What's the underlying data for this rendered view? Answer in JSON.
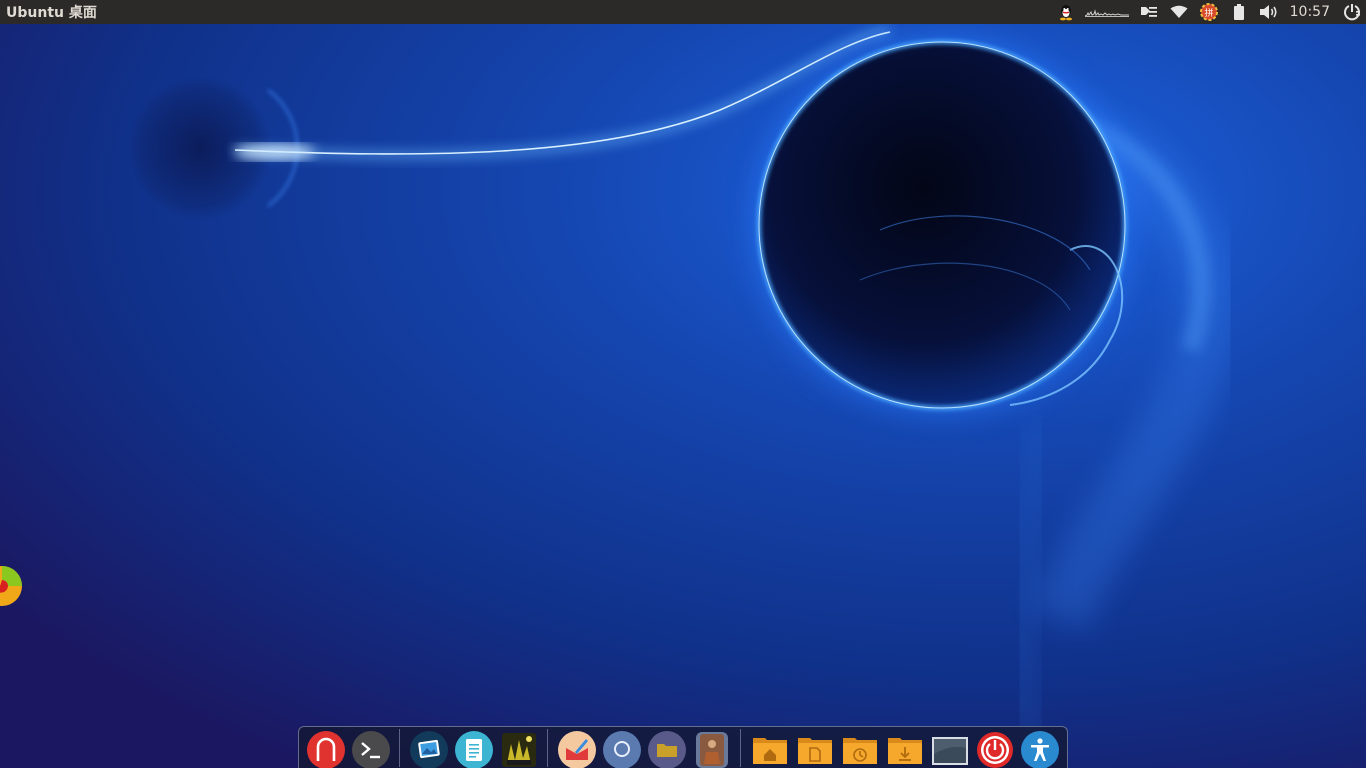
{
  "panel": {
    "title": "Ubuntu 桌面",
    "clock": "10:57"
  },
  "indicators": [
    {
      "name": "qq-icon"
    },
    {
      "name": "system-monitor-graph-icon"
    },
    {
      "name": "messaging-menu-icon"
    },
    {
      "name": "wifi-icon"
    },
    {
      "name": "input-method-icon"
    },
    {
      "name": "battery-icon"
    },
    {
      "name": "volume-icon"
    },
    {
      "name": "session-menu-icon"
    }
  ],
  "dock": {
    "apps": [
      {
        "name": "app-launcher-icon",
        "color": "#e0332f",
        "running": false
      },
      {
        "name": "terminal-icon",
        "color": "#4a4a4c",
        "running": true
      },
      {
        "name": "image-viewer-icon",
        "color": "#1e4a6a",
        "running": false
      },
      {
        "name": "text-editor-icon",
        "color": "#3cb4d2",
        "running": false
      },
      {
        "name": "game-icon",
        "color": "#c9b82a",
        "running": false
      },
      {
        "name": "drawing-app-icon",
        "color": "#f4c9a0",
        "running": false
      },
      {
        "name": "search-icon",
        "color": "#5a7ab0",
        "running": true
      },
      {
        "name": "folder-app-icon",
        "color": "#5a5a8a",
        "running": true
      },
      {
        "name": "photo-app-icon",
        "color": "#8a5a40",
        "running": true
      },
      {
        "name": "home-folder-icon",
        "color": "#f0a030",
        "running": false
      },
      {
        "name": "documents-folder-icon",
        "color": "#f0a030",
        "running": false
      },
      {
        "name": "recent-folder-icon",
        "color": "#f0a030",
        "running": false
      },
      {
        "name": "downloads-folder-icon",
        "color": "#f0a030",
        "running": false
      },
      {
        "name": "show-desktop-icon",
        "color": "#3a4a5a",
        "running": false
      },
      {
        "name": "power-icon",
        "color": "#e02a2a",
        "running": false
      },
      {
        "name": "accessibility-icon",
        "color": "#2a8ad0",
        "running": false
      }
    ]
  },
  "colors": {
    "panel_bg": "#2b2a28",
    "panel_text": "#dfdbd2",
    "wallpaper_glow": "#4aa8ff"
  }
}
